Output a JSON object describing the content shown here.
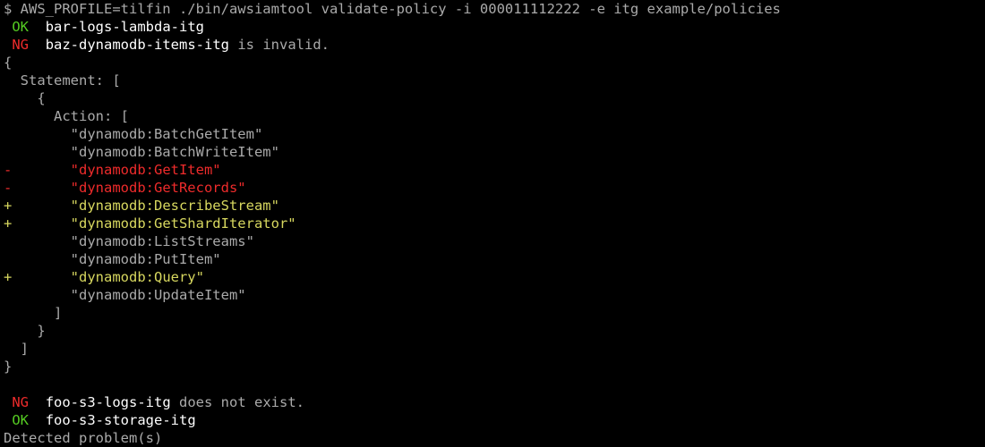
{
  "command": {
    "prompt": "$ ",
    "line": "AWS_PROFILE=tilfin ./bin/awsiamtool validate-policy -i 000011112222 -e itg example/policies"
  },
  "results": {
    "r1": {
      "status": "OK",
      "name": "bar-logs-lambda-itg",
      "msg": ""
    },
    "r2": {
      "status": "NG",
      "name": "baz-dynamodb-items-itg",
      "msg": "is invalid."
    },
    "r3": {
      "status": "NG",
      "name": "foo-s3-logs-itg",
      "msg": "does not exist."
    },
    "r4": {
      "status": "OK",
      "name": "foo-s3-storage-itg",
      "msg": ""
    }
  },
  "json_block": {
    "open_brace": "{",
    "stmt_open": "  Statement: [",
    "obj_open": "    {",
    "action_open": "      Action: [",
    "a1": "        \"dynamodb:BatchGetItem\"",
    "a2": "        \"dynamodb:BatchWriteItem\"",
    "a3_sign": "-",
    "a3": "       \"dynamodb:GetItem\"",
    "a4_sign": "-",
    "a4": "       \"dynamodb:GetRecords\"",
    "a5_sign": "+",
    "a5": "       \"dynamodb:DescribeStream\"",
    "a6_sign": "+",
    "a6": "       \"dynamodb:GetShardIterator\"",
    "a7": "        \"dynamodb:ListStreams\"",
    "a8": "        \"dynamodb:PutItem\"",
    "a9_sign": "+",
    "a9": "       \"dynamodb:Query\"",
    "a10": "        \"dynamodb:UpdateItem\"",
    "action_close": "      ]",
    "obj_close": "    }",
    "stmt_close": "  ]",
    "close_brace": "}"
  },
  "footer": "Detected problem(s)"
}
